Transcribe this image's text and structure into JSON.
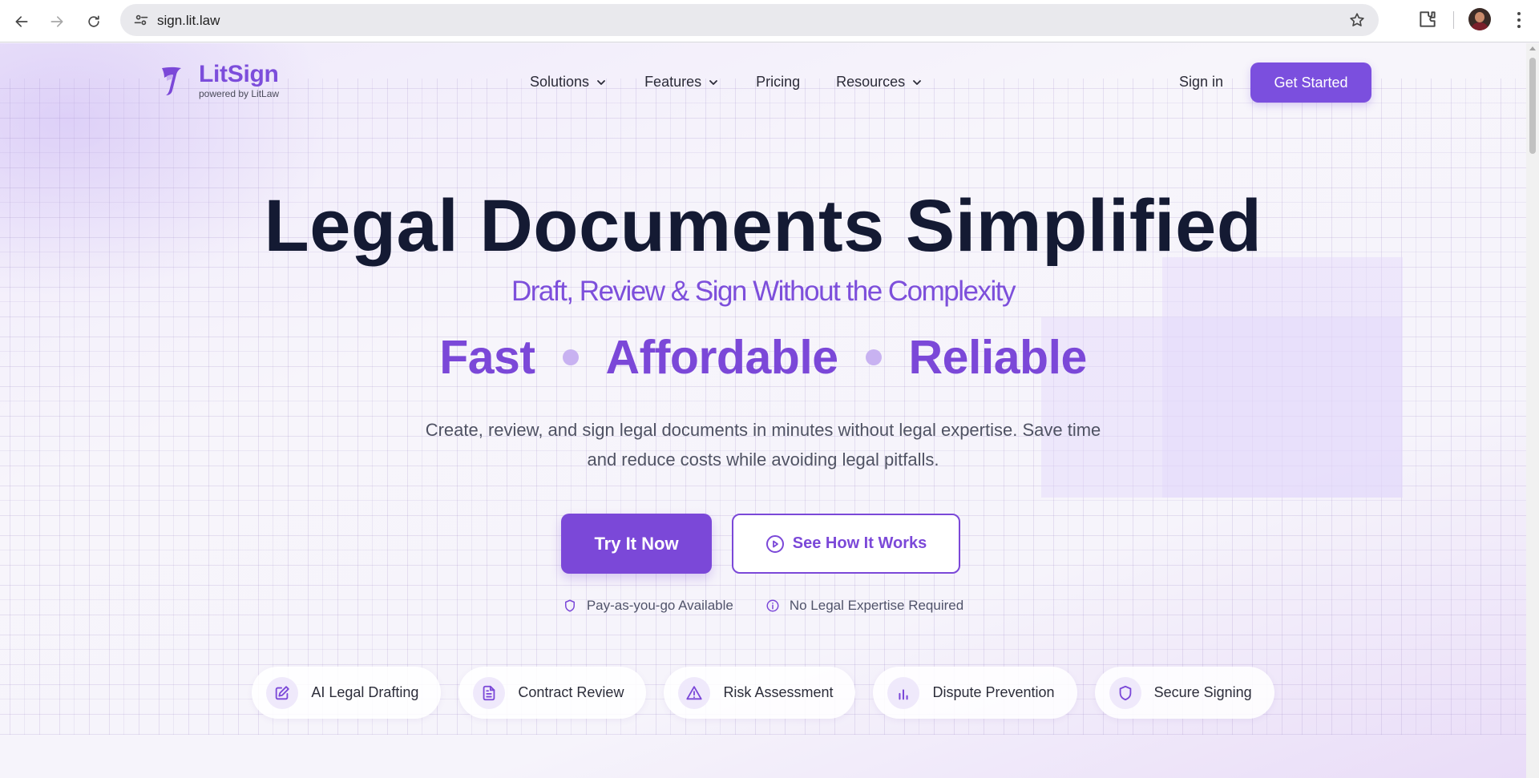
{
  "browser": {
    "url": "sign.lit.law"
  },
  "header": {
    "logo_title": "LitSign",
    "logo_sub": "powered by LitLaw",
    "nav": [
      {
        "label": "Solutions",
        "has_dropdown": true
      },
      {
        "label": "Features",
        "has_dropdown": true
      },
      {
        "label": "Pricing",
        "has_dropdown": false
      },
      {
        "label": "Resources",
        "has_dropdown": true
      }
    ],
    "signin_label": "Sign in",
    "cta_label": "Get Started"
  },
  "hero": {
    "title": "Legal Documents Simplified",
    "subtitle": "Draft, Review & Sign Without the Complexity",
    "pills": [
      "Fast",
      "Affordable",
      "Reliable"
    ],
    "description": "Create, review, and sign legal documents in minutes without legal expertise. Save time and reduce costs while avoiding legal pitfalls.",
    "primary_button": "Try It Now",
    "secondary_button": "See How It Works",
    "notes": [
      {
        "icon": "shield-icon",
        "label": "Pay-as-you-go Available"
      },
      {
        "icon": "info-icon",
        "label": "No Legal Expertise Required"
      }
    ]
  },
  "features": [
    {
      "icon": "edit-icon",
      "label": "AI Legal Drafting"
    },
    {
      "icon": "document-icon",
      "label": "Contract Review"
    },
    {
      "icon": "warning-icon",
      "label": "Risk Assessment"
    },
    {
      "icon": "chart-bars-icon",
      "label": "Dispute Prevention"
    },
    {
      "icon": "shield-icon",
      "label": "Secure Signing"
    }
  ],
  "colors": {
    "brand": "#7b48d8",
    "title": "#141a33",
    "accent_light": "#c8b2f1"
  }
}
